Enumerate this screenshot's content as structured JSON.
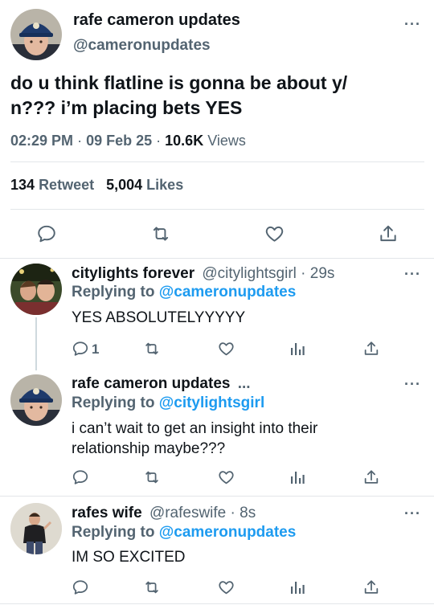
{
  "main_tweet": {
    "display_name": "rafe cameron updates",
    "handle": "@cameronupdates",
    "text_line1": "do u think flatline is gonna be about y/",
    "text_line2": "n??? i’m placing bets YES",
    "time": "02:29 PM",
    "dot1": "·",
    "date": "09 Feb 25",
    "dot2": "·",
    "views_count": "10.6K",
    "views_label": "Views",
    "retweets_count": "134",
    "retweets_label": "Retweet",
    "likes_count": "5,004",
    "likes_label": "Likes",
    "more": "···"
  },
  "replies": [
    {
      "display_name": "citylights forever",
      "handle": "@citylightsgirl",
      "time": "· 29s",
      "replying_prefix": "Replying to",
      "replying_to": "@cameronupdates",
      "text": "YES ABSOLUTELYYYYY",
      "reply_count": "1",
      "more": "···"
    },
    {
      "display_name": "rafe cameron updates",
      "handle_truncated": "...",
      "replying_prefix": "Replying to",
      "replying_to": "@citylightsgirl",
      "text_line1": "i can’t wait to get an insight into their",
      "text_line2": "relationship maybe???",
      "more": "···"
    },
    {
      "display_name": "rafes wife",
      "handle": "@rafeswife",
      "time": "· 8s",
      "replying_prefix": "Replying to",
      "replying_to": "@cameronupdates",
      "text": "IM SO EXCITED",
      "more": "···"
    }
  ],
  "colors": {
    "accent": "#1d9bf0",
    "text": "#0f1419",
    "secondary": "#536471",
    "divider": "#e3e6e9"
  }
}
